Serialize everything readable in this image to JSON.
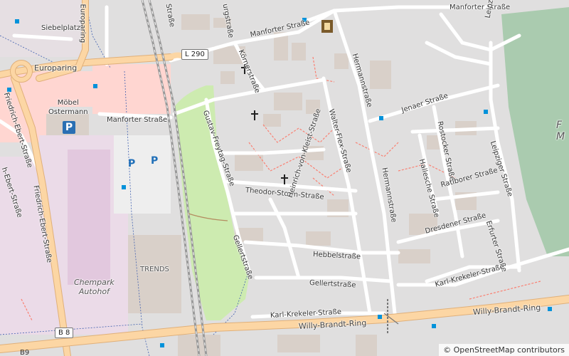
{
  "map": {
    "attribution": "© OpenStreetMap contributors",
    "road_refs": {
      "l290": "L 290",
      "b8": "B 8",
      "b9": "B9"
    },
    "streets": {
      "manforter_top": "Manforter Straße",
      "manforter_left": "Manforter Straße",
      "europaring": "Europaring",
      "europaring_top": "Europaring",
      "siebelplatz": "Siebelplatz",
      "friedrich_ebert_1": "Friedrich-Ebert-Straße",
      "friedrich_ebert_2": "Friedrich-Ebert-Straße",
      "ebert_top": "h-Ebert-Straße",
      "gustav_freytag": "Gustav-Freytag-Straße",
      "koerner": "Körnerstraße",
      "burgstrasse": "urgstraße",
      "top_left_str": "Straße",
      "hermann_top": "Hermannstraße",
      "hermann_bottom": "Hermannstraße",
      "walter_flex": "Walter-Flex-Straße",
      "jenaer": "Jenaer Straße",
      "rostocker": "Rostocker Straße",
      "hallesche": "Hallesche Straße",
      "ratiborer": "Ratiborer Straße",
      "leipziger_top": "Leipziger Straße",
      "leipziger_mid": "Leipziger Straße",
      "theodor_storm": "Theodor-Storm-Straße",
      "heinrich_kleist": "Heinrich-von-Kleist-Straße",
      "dresdener": "Dresdener Straße",
      "erfurter": "Erfurter Straße",
      "hebbel": "Hebbelstraße",
      "gellert_vert": "Gellertstraße",
      "gellert_horiz": "Gellertstraße",
      "karl_krekeler_1": "Karl-Krekeler-Straße",
      "karl_krekeler_2": "Karl-Krekeler-Straße",
      "willy_brandt_1": "Willy-Brandt-Ring",
      "willy_brandt_2": "Willy-Brandt-Ring"
    },
    "places": {
      "moebel": "Möbel\nOstermann",
      "trends": "TRENDS",
      "chempark": "Chempark\nAutohof",
      "cemetery": "F\nM"
    },
    "parking_symbol": "P",
    "colors": {
      "background": "#e0dfdf",
      "major_road": "#fcd6a4",
      "major_road_edge": "#e0b07a",
      "minor_road": "#ffffff",
      "retail": "#ffd6d1",
      "industrial": "#ebdbe8",
      "park": "#cdebb0",
      "cemetery": "#aacbaf",
      "railway": "#999999",
      "building": "#d9d0c9",
      "path": "#fa8072",
      "bus_stop": "#0092da"
    }
  }
}
